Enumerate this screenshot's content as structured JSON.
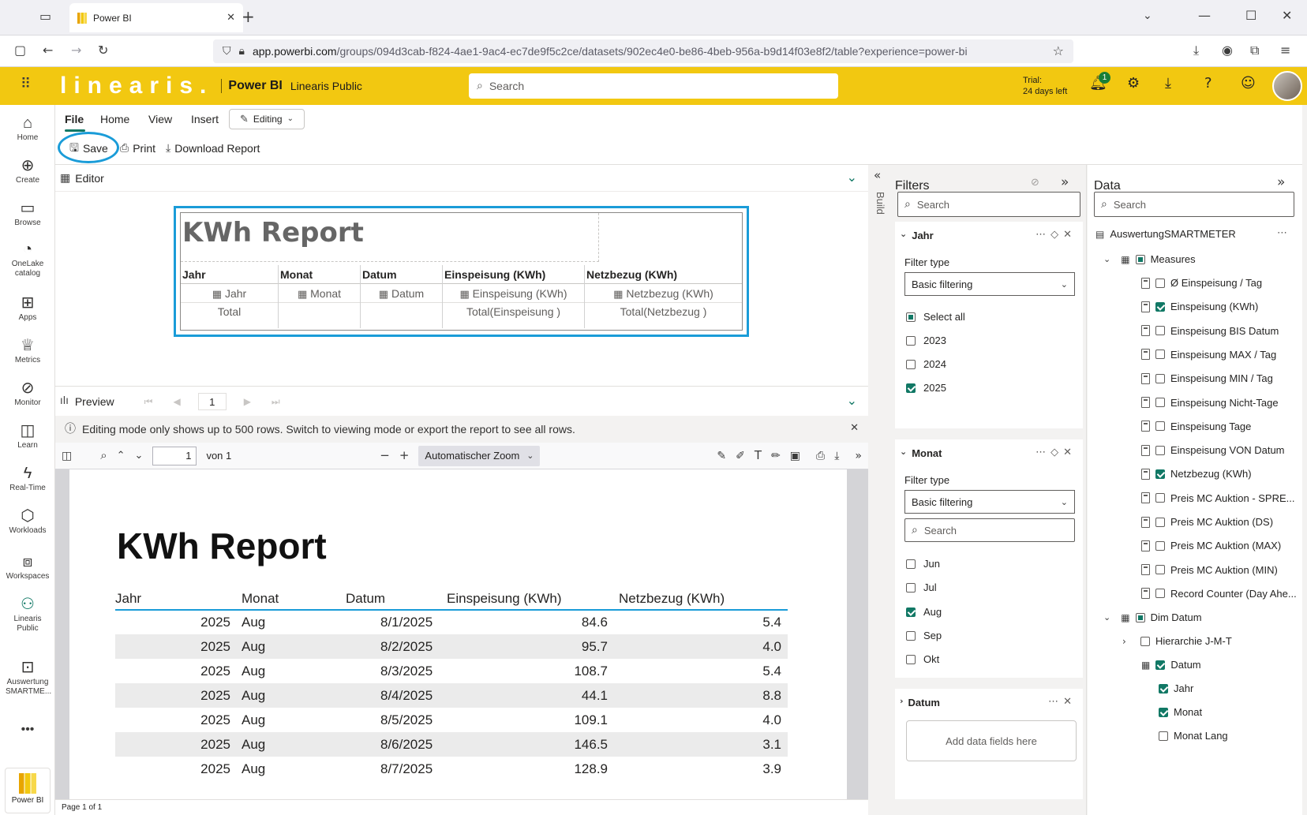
{
  "browser": {
    "tab_title": "Power BI",
    "url_host": "app.powerbi.com",
    "url_path": "/groups/094d3cab-f824-4ae1-9ac4-ec7de9f5c2ce/datasets/902ec4e0-be86-4beb-956a-b9d14f03e8f2/table?experience=power-bi"
  },
  "header": {
    "brand": "linearis.",
    "product": "Power BI",
    "workspace": "Linearis Public",
    "search_placeholder": "Search",
    "trial_line1": "Trial:",
    "trial_line2": "24 days left",
    "notification_count": "1",
    "accent_color": "#f2c811"
  },
  "nav": {
    "items": [
      "Home",
      "Create",
      "Browse",
      "OneLake catalog",
      "Apps",
      "Metrics",
      "Monitor",
      "Learn",
      "Real-Time",
      "Workloads",
      "Workspaces",
      "Linearis Public",
      "Auswertung SMARTME...",
      "Power BI"
    ]
  },
  "ribbon": {
    "tabs": [
      "File",
      "Home",
      "View",
      "Insert"
    ],
    "mode": "Editing",
    "commands": [
      "Save",
      "Print",
      "Download Report"
    ]
  },
  "editor": {
    "label": "Editor",
    "report_title": "KWh Report",
    "columns": [
      {
        "header": "Jahr",
        "field": "Jahr",
        "total": "Total"
      },
      {
        "header": "Monat",
        "field": "Monat",
        "total": ""
      },
      {
        "header": "Datum",
        "field": "Datum",
        "total": ""
      },
      {
        "header": "Einspeisung (KWh)",
        "field": "Einspeisung (KWh)",
        "total": "Total(Einspeisung )"
      },
      {
        "header": "Netzbezug (KWh)",
        "field": "Netzbezug (KWh)",
        "total": "Total(Netzbezug )"
      }
    ]
  },
  "preview": {
    "label": "Preview",
    "page": "1",
    "info": "Editing mode only shows up to 500 rows. Switch to viewing mode or export the report to see all rows.",
    "pdf_page": "1",
    "pdf_of": "von 1",
    "zoom": "Automatischer Zoom",
    "status": "Page 1 of 1",
    "title": "KWh Report",
    "headers": [
      "Jahr",
      "Monat",
      "Datum",
      "Einspeisung (KWh)",
      "Netzbezug (KWh)"
    ],
    "rows": [
      [
        "2025",
        "Aug",
        "8/1/2025",
        "84.6",
        "5.4"
      ],
      [
        "2025",
        "Aug",
        "8/2/2025",
        "95.7",
        "4.0"
      ],
      [
        "2025",
        "Aug",
        "8/3/2025",
        "108.7",
        "5.4"
      ],
      [
        "2025",
        "Aug",
        "8/4/2025",
        "44.1",
        "8.8"
      ],
      [
        "2025",
        "Aug",
        "8/5/2025",
        "109.1",
        "4.0"
      ],
      [
        "2025",
        "Aug",
        "8/6/2025",
        "146.5",
        "3.1"
      ],
      [
        "2025",
        "Aug",
        "8/7/2025",
        "128.9",
        "3.9"
      ]
    ]
  },
  "build_label": "Build",
  "filters": {
    "title": "Filters",
    "search_placeholder": "Search",
    "jahr": {
      "title": "Jahr",
      "type_label": "Filter type",
      "type_value": "Basic filtering",
      "options": [
        {
          "label": "Select all",
          "checked": "partial"
        },
        {
          "label": "2023",
          "checked": "no"
        },
        {
          "label": "2024",
          "checked": "no"
        },
        {
          "label": "2025",
          "checked": "yes"
        }
      ]
    },
    "monat": {
      "title": "Monat",
      "type_label": "Filter type",
      "type_value": "Basic filtering",
      "search_placeholder": "Search",
      "options": [
        {
          "label": "Jun",
          "checked": "no"
        },
        {
          "label": "Jul",
          "checked": "no"
        },
        {
          "label": "Aug",
          "checked": "yes"
        },
        {
          "label": "Sep",
          "checked": "no"
        },
        {
          "label": "Okt",
          "checked": "no"
        }
      ]
    },
    "datum": {
      "title": "Datum",
      "add_fields": "Add data fields here"
    }
  },
  "data": {
    "title": "Data",
    "search_placeholder": "Search",
    "model": "AuswertungSMARTMETER",
    "measures_group": "Measures",
    "measures": [
      {
        "label": "Ø Einspeisung / Tag",
        "checked": "no"
      },
      {
        "label": "Einspeisung (KWh)",
        "checked": "yes"
      },
      {
        "label": "Einspeisung BIS Datum",
        "checked": "no"
      },
      {
        "label": "Einspeisung MAX / Tag",
        "checked": "no"
      },
      {
        "label": "Einspeisung MIN / Tag",
        "checked": "no"
      },
      {
        "label": "Einspeisung Nicht-Tage",
        "checked": "no"
      },
      {
        "label": "Einspeisung Tage",
        "checked": "no"
      },
      {
        "label": "Einspeisung VON Datum",
        "checked": "no"
      },
      {
        "label": "Netzbezug (KWh)",
        "checked": "yes"
      },
      {
        "label": "Preis MC Auktion - SPRE...",
        "checked": "no"
      },
      {
        "label": "Preis MC Auktion (DS)",
        "checked": "no"
      },
      {
        "label": "Preis MC Auktion (MAX)",
        "checked": "no"
      },
      {
        "label": "Preis MC Auktion (MIN)",
        "checked": "no"
      },
      {
        "label": "Record Counter (Day Ahe...",
        "checked": "no"
      }
    ],
    "dim_group": "Dim Datum",
    "dim_items": [
      {
        "label": "Hierarchie J-M-T",
        "checked": "no"
      },
      {
        "label": "Datum",
        "checked": "yes"
      },
      {
        "label": "Jahr",
        "checked": "yes"
      },
      {
        "label": "Monat",
        "checked": "yes"
      },
      {
        "label": "Monat Lang",
        "checked": "no"
      }
    ]
  }
}
